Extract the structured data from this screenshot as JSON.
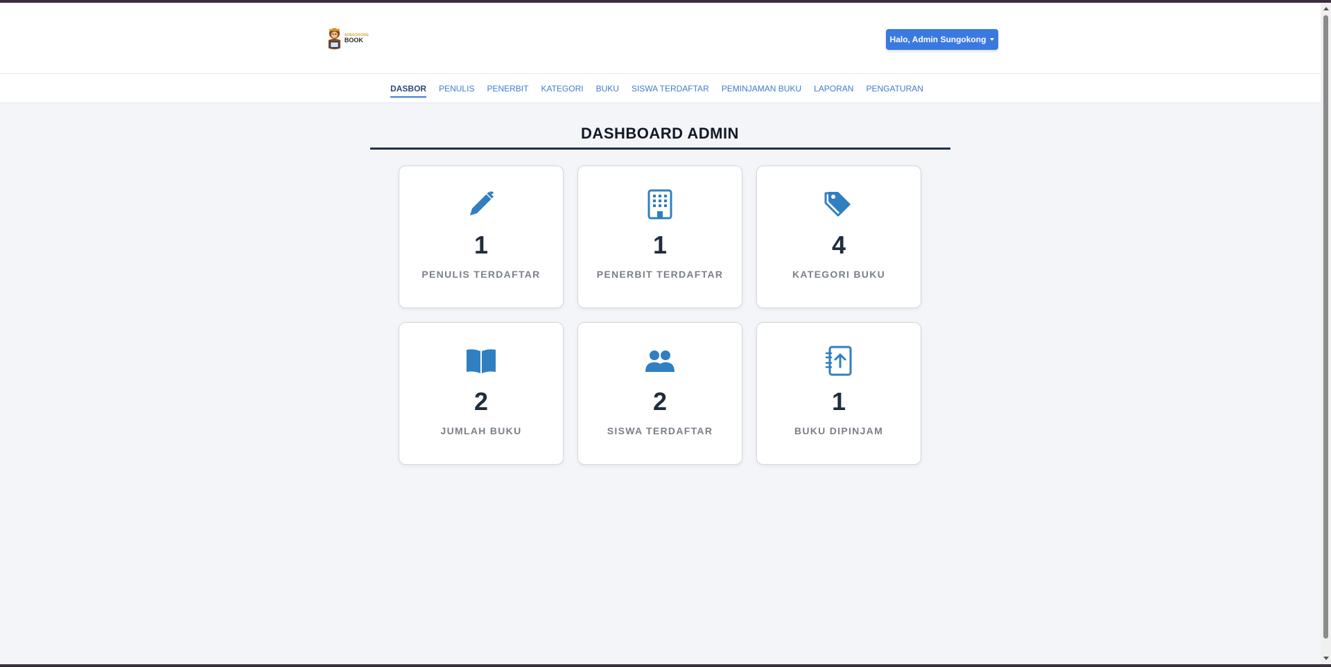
{
  "header": {
    "logo_small": "SUNGOKONG",
    "logo_big": "BOOK",
    "user_button": "Halo, Admin Sungokong"
  },
  "nav": {
    "items": [
      {
        "label": "DASBOR",
        "active": true
      },
      {
        "label": "PENULIS"
      },
      {
        "label": "PENERBIT"
      },
      {
        "label": "KATEGORI"
      },
      {
        "label": "BUKU"
      },
      {
        "label": "SISWA TERDAFTAR"
      },
      {
        "label": "PEMINJAMAN BUKU"
      },
      {
        "label": "LAPORAN"
      },
      {
        "label": "PENGATURAN"
      }
    ]
  },
  "main": {
    "title": "DASHBOARD ADMIN",
    "cards": [
      {
        "icon": "pen-icon",
        "value": "1",
        "label": "PENULIS TERDAFTAR"
      },
      {
        "icon": "building-icon",
        "value": "1",
        "label": "PENERBIT TERDAFTAR"
      },
      {
        "icon": "tags-icon",
        "value": "4",
        "label": "KATEGORI BUKU"
      },
      {
        "icon": "book-open-icon",
        "value": "2",
        "label": "JUMLAH BUKU"
      },
      {
        "icon": "users-icon",
        "value": "2",
        "label": "SISWA TERDAFTAR"
      },
      {
        "icon": "book-upload-icon",
        "value": "1",
        "label": "BUKU DIPINJAM"
      }
    ]
  },
  "colors": {
    "accent": "#3a7ae0",
    "icon": "#2f7fc1",
    "title_rule": "#1e2f4d"
  }
}
